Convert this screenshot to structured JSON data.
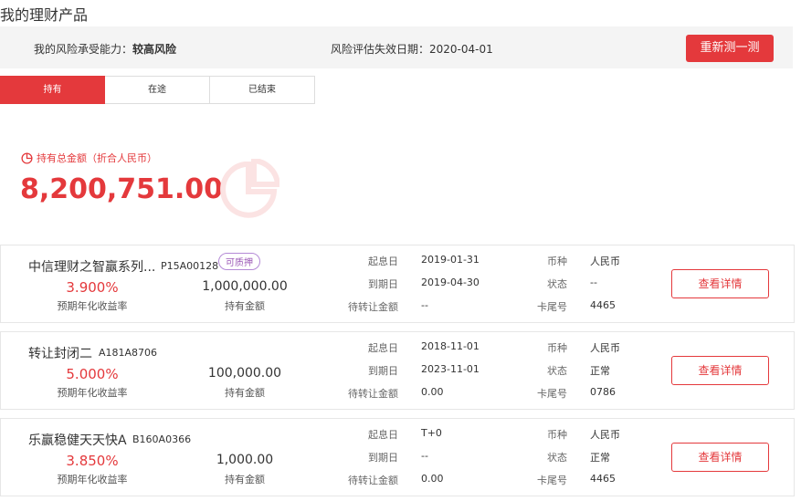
{
  "page": {
    "title": "我的理财产品"
  },
  "risk": {
    "label": "我的风险承受能力：",
    "level": "较高风险",
    "expire_label": "风险评估失效日期：",
    "expire_date": "2020-04-01",
    "retest_button": "重新测一测"
  },
  "tabs": [
    {
      "label": "持有",
      "active": true
    },
    {
      "label": "在途",
      "active": false
    },
    {
      "label": "已结束",
      "active": false
    }
  ],
  "summary": {
    "total_label": "持有总金额（折合人民币）",
    "total_amount": "8,200,751.00"
  },
  "field_labels": {
    "rate": "预期年化收益率",
    "amount": "持有金额",
    "start_date": "起息日",
    "end_date": "到期日",
    "transfer_amount": "待转让金额",
    "currency": "币种",
    "status": "状态",
    "card_tail": "卡尾号",
    "detail_button": "查看详情"
  },
  "products": [
    {
      "name": "中信理财之智赢系列...",
      "code": "P15A00128",
      "tag": "可质押",
      "rate": "3.900%",
      "amount": "1,000,000.00",
      "start_date": "2019-01-31",
      "end_date": "2019-04-30",
      "transfer_amount": "--",
      "currency": "人民币",
      "status": "--",
      "card_tail": "4465"
    },
    {
      "name": "转让封闭二",
      "code": "A181A8706",
      "tag": "",
      "rate": "5.000%",
      "amount": "100,000.00",
      "start_date": "2018-11-01",
      "end_date": "2023-11-01",
      "transfer_amount": "0.00",
      "currency": "人民币",
      "status": "正常",
      "card_tail": "0786"
    },
    {
      "name": "乐赢稳健天天快A",
      "code": "B160A0366",
      "tag": "",
      "rate": "3.850%",
      "amount": "1,000.00",
      "start_date": "T+0",
      "end_date": "--",
      "transfer_amount": "0.00",
      "currency": "人民币",
      "status": "正常",
      "card_tail": "4465"
    }
  ],
  "colors": {
    "accent": "#e4393c",
    "tag": "#9b59b6",
    "panel": "#f4f4f4"
  }
}
